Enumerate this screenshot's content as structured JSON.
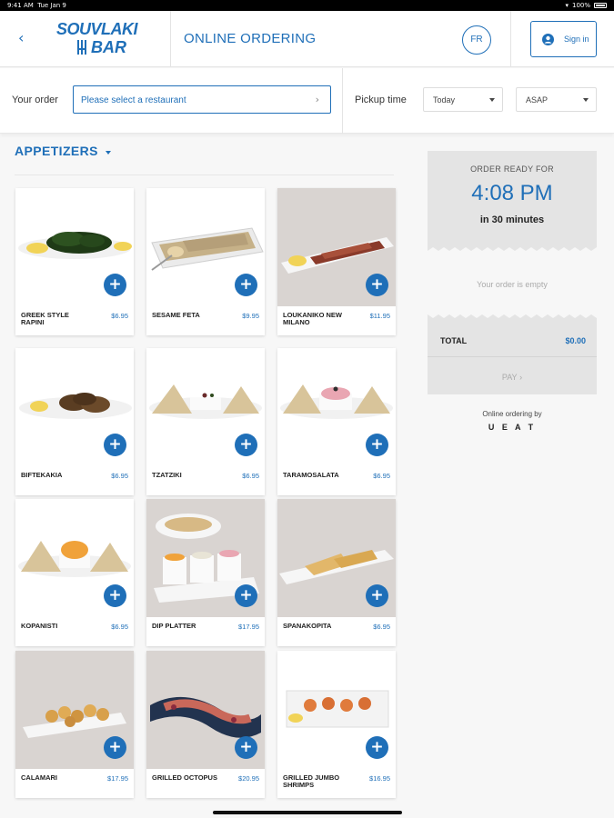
{
  "status": {
    "time": "9:41 AM",
    "date": "Tue Jan 9",
    "battery": "100%"
  },
  "header": {
    "logo_line1": "SOUVLAKI",
    "logo_line2": "BAR",
    "title": "ONLINE ORDERING",
    "lang": "FR",
    "signin_label": "Sign in"
  },
  "order_bar": {
    "your_order_label": "Your order",
    "restaurant_placeholder": "Please select a restaurant",
    "pickup_label": "Pickup time",
    "day_value": "Today",
    "time_value": "ASAP"
  },
  "section": {
    "title": "APPETIZERS"
  },
  "menu": [
    {
      "name": "GREEK STYLE RAPINI",
      "price": "$6.95",
      "photo": "rapini"
    },
    {
      "name": "SESAME FETA",
      "price": "$9.95",
      "photo": "feta"
    },
    {
      "name": "LOUKANIKO NEW MILANO",
      "price": "$11.95",
      "photo": "sausage"
    },
    {
      "name": "BIFTEKAKIA",
      "price": "$6.95",
      "photo": "biftekakia"
    },
    {
      "name": "TZATZIKI",
      "price": "$6.95",
      "photo": "tzatziki"
    },
    {
      "name": "TARAMOSALATA",
      "price": "$6.95",
      "photo": "taramosalata"
    },
    {
      "name": "KOPANISTI",
      "price": "$6.95",
      "photo": "kopanisti"
    },
    {
      "name": "DIP PLATTER",
      "price": "$17.95",
      "photo": "dip-platter"
    },
    {
      "name": "SPANAKOPITA",
      "price": "$6.95",
      "photo": "spanakopita"
    },
    {
      "name": "CALAMARI",
      "price": "$17.95",
      "photo": "calamari"
    },
    {
      "name": "GRILLED OCTOPUS",
      "price": "$20.95",
      "photo": "octopus"
    },
    {
      "name": "GRILLED JUMBO SHRIMPS",
      "price": "$16.95",
      "photo": "shrimps"
    }
  ],
  "order_panel": {
    "ready_label": "ORDER READY FOR",
    "ready_time": "4:08 PM",
    "ready_in": "in 30 minutes",
    "empty_text": "Your order is empty",
    "total_label": "TOTAL",
    "total_value": "$0.00",
    "pay_label": "PAY",
    "powered_by": "Online ordering by",
    "powered_brand": "U E A T"
  },
  "colors": {
    "accent": "#1f6fb8",
    "panel_bg": "#e4e4e4"
  }
}
